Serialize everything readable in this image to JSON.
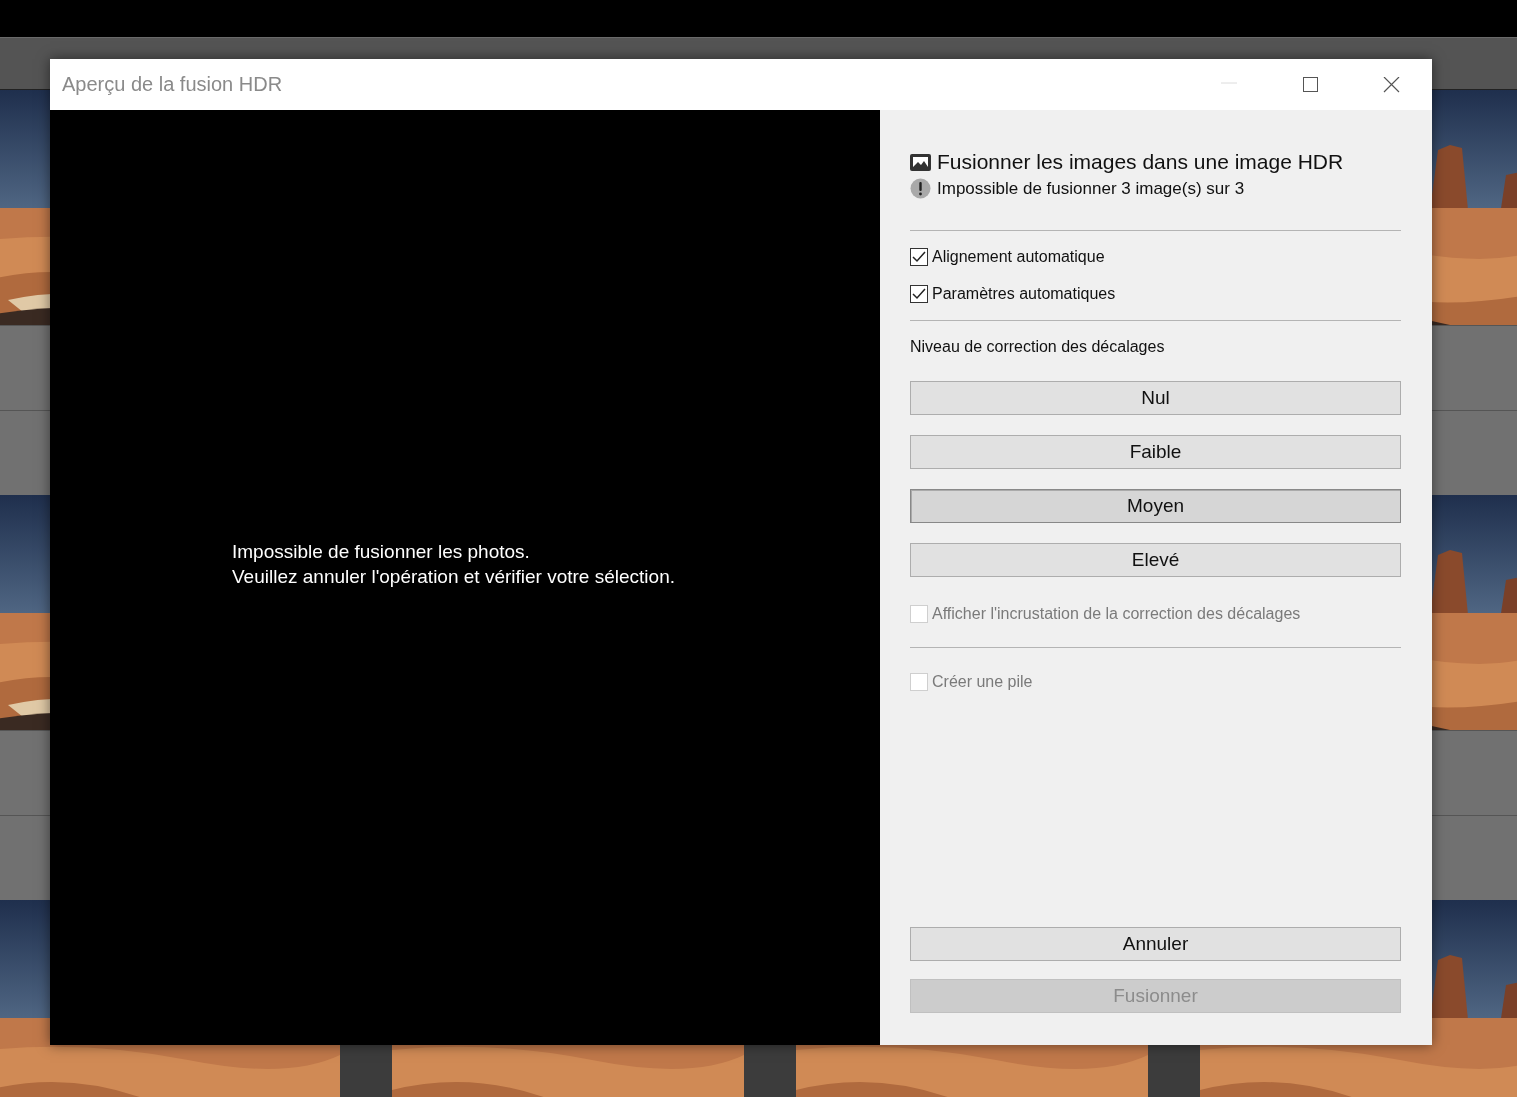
{
  "window": {
    "title": "Aperçu de la fusion HDR",
    "controls": [
      {
        "kind": "minimize",
        "disabled": true
      },
      {
        "kind": "maximize",
        "disabled": false
      },
      {
        "kind": "close",
        "disabled": false
      }
    ]
  },
  "preview": {
    "message": [
      "Impossible de fusionner les photos.",
      "Veuillez annuler l'opération et vérifier votre sélection."
    ]
  },
  "panel": {
    "heading": "Fusionner les images dans une image HDR",
    "warning": "Impossible de fusionner 3 image(s) sur 3",
    "options": [
      {
        "label": "Alignement automatique",
        "checked": true,
        "disabled": false
      },
      {
        "label": "Paramètres automatiques",
        "checked": true,
        "disabled": false
      }
    ],
    "deghost": {
      "label": "Niveau de correction des décalages",
      "levels": [
        {
          "label": "Nul",
          "selected": false
        },
        {
          "label": "Faible",
          "selected": false
        },
        {
          "label": "Moyen",
          "selected": true
        },
        {
          "label": "Elevé",
          "selected": false
        }
      ]
    },
    "overlay": {
      "label": "Afficher l'incrustation de la correction des décalages",
      "checked": false,
      "disabled": true
    },
    "stack": {
      "label": "Créer une pile",
      "checked": false,
      "disabled": true
    },
    "buttons": [
      {
        "label": "Annuler",
        "disabled": false
      },
      {
        "label": "Fusionner",
        "disabled": true
      }
    ]
  }
}
